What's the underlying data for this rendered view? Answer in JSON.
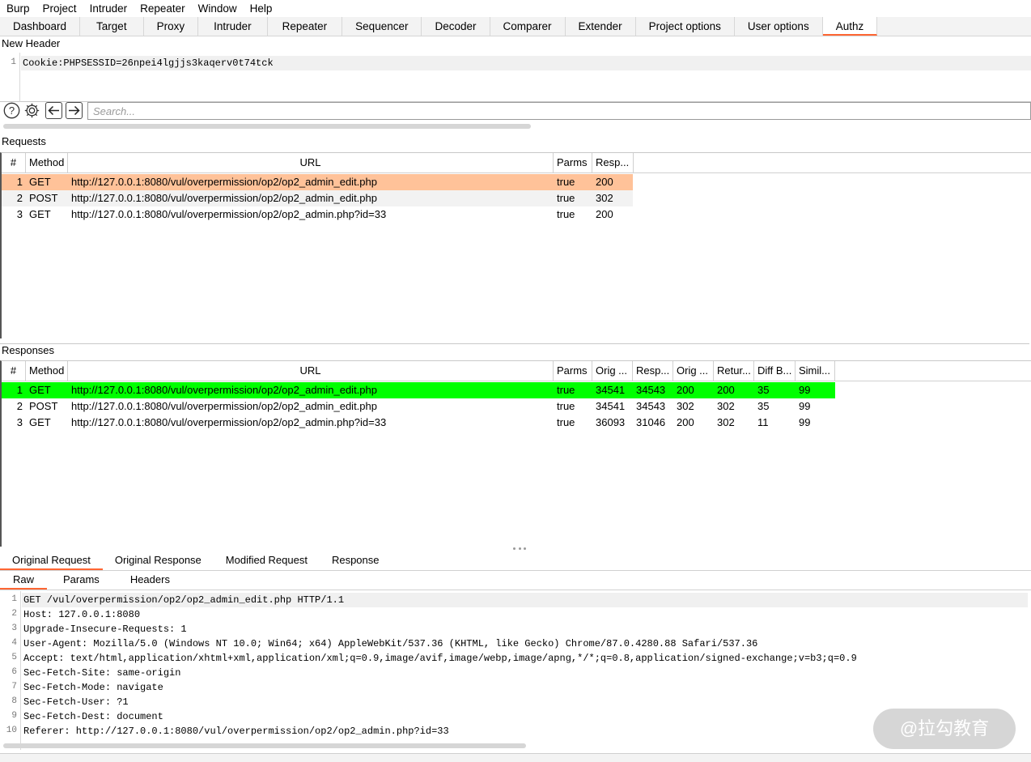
{
  "menu": [
    "Burp",
    "Project",
    "Intruder",
    "Repeater",
    "Window",
    "Help"
  ],
  "top_tabs": [
    "Dashboard",
    "Target",
    "Proxy",
    "Intruder",
    "Repeater",
    "Sequencer",
    "Decoder",
    "Comparer",
    "Extender",
    "Project options",
    "User options",
    "Authz"
  ],
  "active_top_tab": "Authz",
  "new_header": {
    "title": "New Header",
    "line_number": "1",
    "value": "Cookie:PHPSESSID=26npei4lgjjs3kaqerv0t74tck"
  },
  "search": {
    "placeholder": "Search..."
  },
  "requests": {
    "title": "Requests",
    "columns": [
      "#",
      "Method",
      "URL",
      "Parms",
      "Resp..."
    ],
    "rows": [
      {
        "n": "1",
        "method": "GET",
        "url": "http://127.0.0.1:8080/vul/overpermission/op2/op2_admin_edit.php",
        "parms": "true",
        "resp": "200"
      },
      {
        "n": "2",
        "method": "POST",
        "url": "http://127.0.0.1:8080/vul/overpermission/op2/op2_admin_edit.php",
        "parms": "true",
        "resp": "302"
      },
      {
        "n": "3",
        "method": "GET",
        "url": "http://127.0.0.1:8080/vul/overpermission/op2/op2_admin.php?id=33",
        "parms": "true",
        "resp": "200"
      }
    ]
  },
  "responses": {
    "title": "Responses",
    "columns": [
      "#",
      "Method",
      "URL",
      "Parms",
      "Orig ...",
      "Resp...",
      "Orig ...",
      "Retur...",
      "Diff B...",
      "Simil..."
    ],
    "rows": [
      {
        "n": "1",
        "method": "GET",
        "url": "http://127.0.0.1:8080/vul/overpermission/op2/op2_admin_edit.php",
        "parms": "true",
        "orig_len": "34541",
        "resp_len": "34543",
        "orig_code": "200",
        "ret_code": "200",
        "diff": "35",
        "sim": "99"
      },
      {
        "n": "2",
        "method": "POST",
        "url": "http://127.0.0.1:8080/vul/overpermission/op2/op2_admin_edit.php",
        "parms": "true",
        "orig_len": "34541",
        "resp_len": "34543",
        "orig_code": "302",
        "ret_code": "302",
        "diff": "35",
        "sim": "99"
      },
      {
        "n": "3",
        "method": "GET",
        "url": "http://127.0.0.1:8080/vul/overpermission/op2/op2_admin.php?id=33",
        "parms": "true",
        "orig_len": "36093",
        "resp_len": "31046",
        "orig_code": "200",
        "ret_code": "302",
        "diff": "11",
        "sim": "99"
      }
    ]
  },
  "bottom_tabs": [
    "Original Request",
    "Original Response",
    "Modified Request",
    "Response"
  ],
  "active_bottom_tab": "Original Request",
  "sub_tabs": [
    "Raw",
    "Params",
    "Headers"
  ],
  "active_sub_tab": "Raw",
  "raw_lines": [
    {
      "n": "1",
      "text": "GET /vul/overpermission/op2/op2_admin_edit.php HTTP/1.1"
    },
    {
      "n": "2",
      "text": "Host: 127.0.0.1:8080"
    },
    {
      "n": "3",
      "text": "Upgrade-Insecure-Requests: 1"
    },
    {
      "n": "4",
      "text": "User-Agent: Mozilla/5.0 (Windows NT 10.0; Win64; x64) AppleWebKit/537.36 (KHTML, like Gecko) Chrome/87.0.4280.88 Safari/537.36"
    },
    {
      "n": "5",
      "text": "Accept: text/html,application/xhtml+xml,application/xml;q=0.9,image/avif,image/webp,image/apng,*/*;q=0.8,application/signed-exchange;v=b3;q=0.9"
    },
    {
      "n": "6",
      "text": "Sec-Fetch-Site: same-origin"
    },
    {
      "n": "7",
      "text": "Sec-Fetch-Mode: navigate"
    },
    {
      "n": "8",
      "text": "Sec-Fetch-User: ?1"
    },
    {
      "n": "9",
      "text": "Sec-Fetch-Dest: document"
    },
    {
      "n": "10",
      "text": "Referer: http://127.0.0.1:8080/vul/overpermission/op2/op2_admin.php?id=33"
    }
  ],
  "watermark": "@拉勾教育",
  "colors": {
    "accent": "#ff6633",
    "selected_request_row": "#ffc299",
    "highlight_response_row": "#00ff00",
    "alt_row": "#f2f2f2"
  }
}
